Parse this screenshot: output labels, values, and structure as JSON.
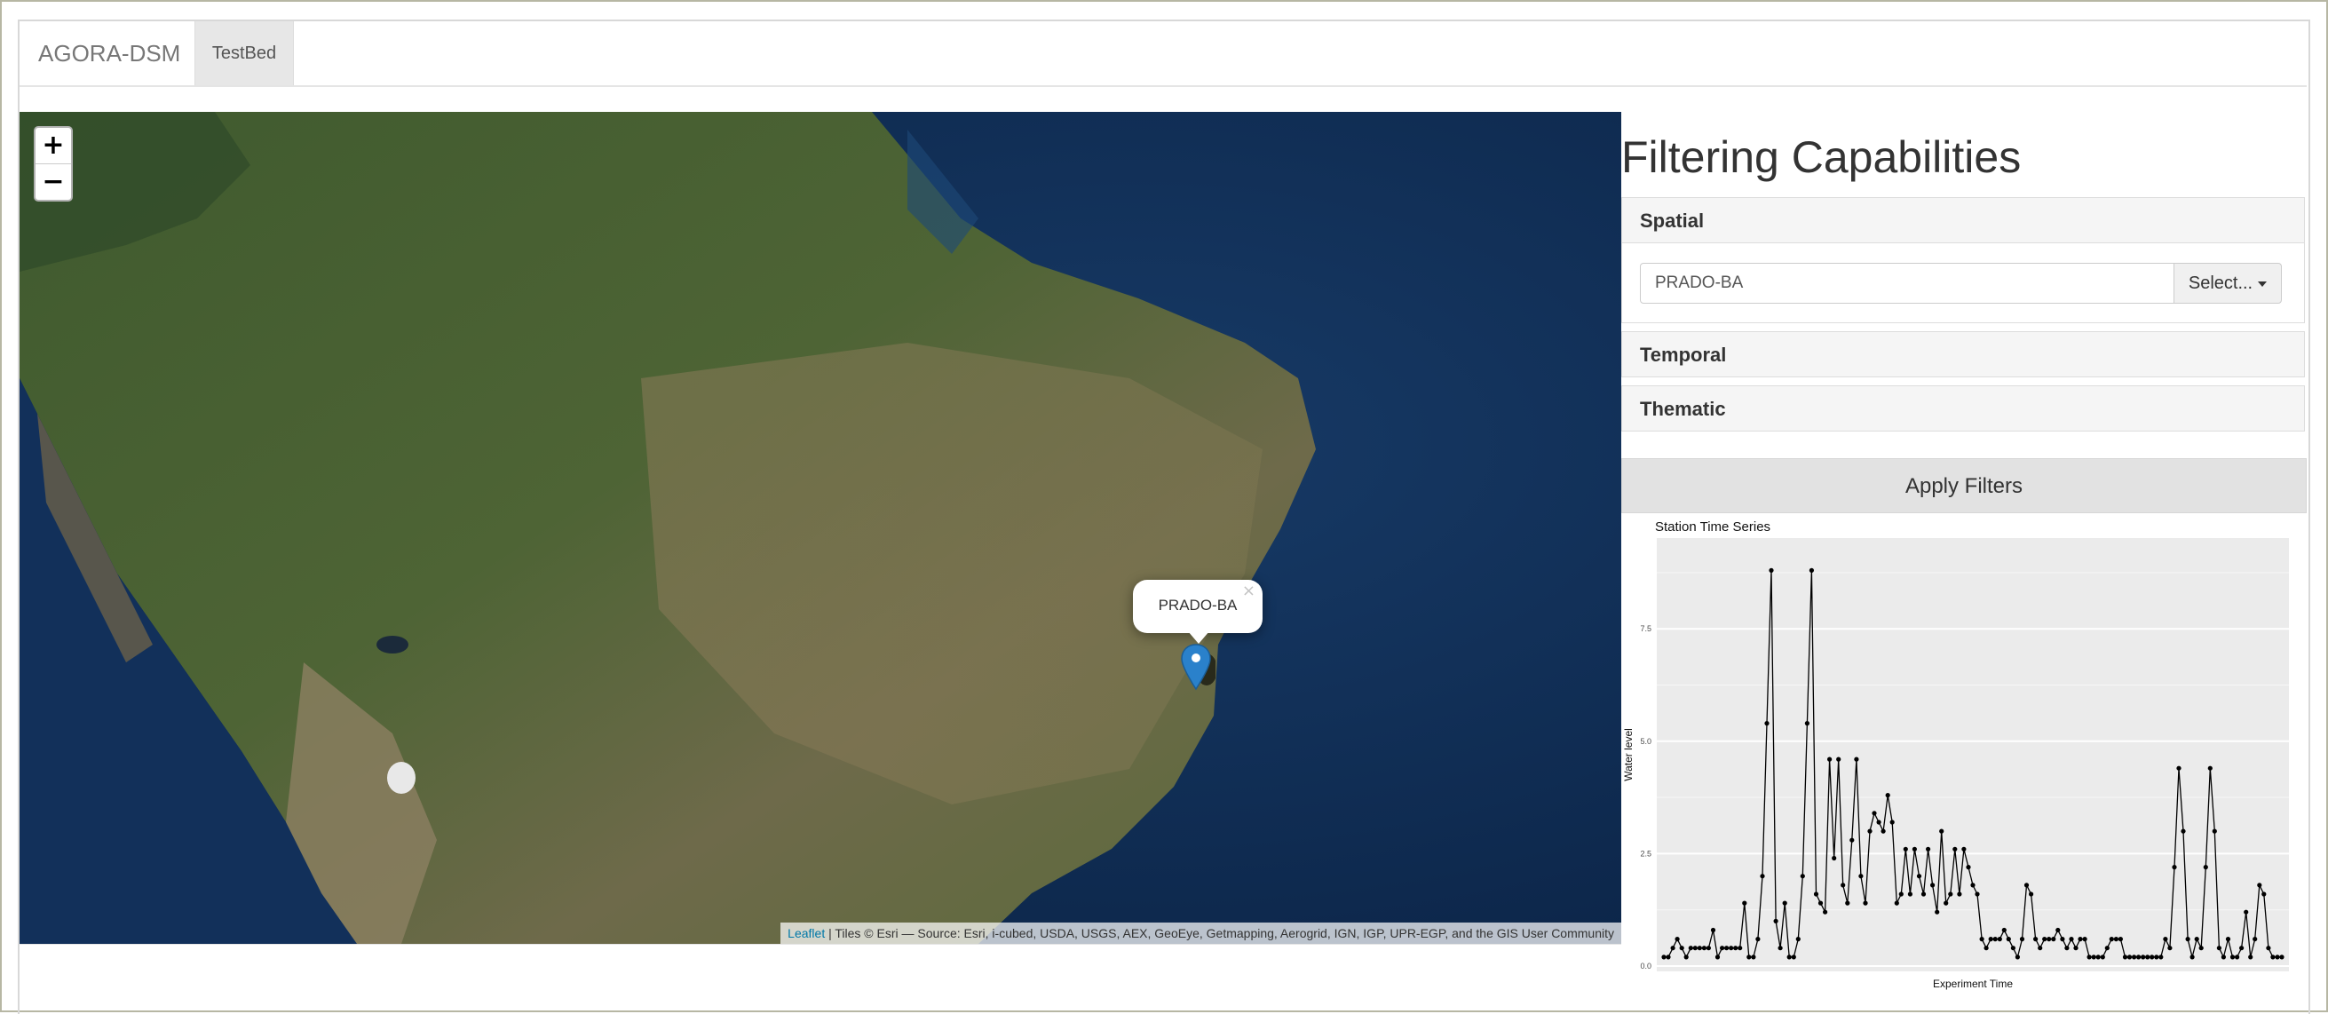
{
  "navbar": {
    "brand": "AGORA-DSM",
    "tabs": [
      {
        "label": "TestBed",
        "active": true
      }
    ]
  },
  "map": {
    "zoom_in": "+",
    "zoom_out": "−",
    "popup_label": "PRADO-BA",
    "popup_close": "×",
    "attribution": {
      "link": "Leaflet",
      "text": " | Tiles © Esri — Source: Esri, i-cubed, USDA, USGS, AEX, GeoEye, Getmapping, Aerogrid, IGN, IGP, UPR-EGP, and the GIS User Community"
    },
    "marker_color": "#2a81cb"
  },
  "panel": {
    "title": "Filtering Capabilities",
    "sections": {
      "spatial": "Spatial",
      "temporal": "Temporal",
      "thematic": "Thematic"
    },
    "spatial_value": "PRADO-BA",
    "select_label": "Select...",
    "apply_label": "Apply Filters"
  },
  "chart_data": {
    "type": "line",
    "title": "Station Time Series",
    "xlabel": "Experiment Time",
    "ylabel": "Water level",
    "ylim": [
      0,
      9.4
    ],
    "yticks": [
      "0.0",
      "2.5",
      "5.0",
      "7.5"
    ],
    "grid": true,
    "series": [
      {
        "values": [
          0.2,
          0.2,
          0.4,
          0.6,
          0.4,
          0.2,
          0.4,
          0.4,
          0.4,
          0.4,
          0.4,
          0.8,
          0.2,
          0.4,
          0.4,
          0.4,
          0.4,
          0.4,
          1.4,
          0.2,
          0.2,
          0.6,
          2.0,
          5.4,
          8.8,
          1.0,
          0.4,
          1.4,
          0.2,
          0.2,
          0.6,
          2.0,
          5.4,
          8.8,
          1.6,
          1.4,
          1.2,
          4.6,
          2.4,
          4.6,
          1.8,
          1.4,
          2.8,
          4.6,
          2.0,
          1.4,
          3.0,
          3.4,
          3.2,
          3.0,
          3.8,
          3.2,
          1.4,
          1.6,
          2.6,
          1.6,
          2.6,
          2.0,
          1.6,
          2.6,
          1.8,
          1.2,
          3.0,
          1.4,
          1.6,
          2.6,
          1.6,
          2.6,
          2.2,
          1.8,
          1.6,
          0.6,
          0.4,
          0.6,
          0.6,
          0.6,
          0.8,
          0.6,
          0.4,
          0.2,
          0.6,
          1.8,
          1.6,
          0.6,
          0.4,
          0.6,
          0.6,
          0.6,
          0.8,
          0.6,
          0.4,
          0.6,
          0.4,
          0.6,
          0.6,
          0.2,
          0.2,
          0.2,
          0.2,
          0.4,
          0.6,
          0.6,
          0.6,
          0.2,
          0.2,
          0.2,
          0.2,
          0.2,
          0.2,
          0.2,
          0.2,
          0.2,
          0.6,
          0.4,
          2.2,
          4.4,
          3.0,
          0.6,
          0.2,
          0.6,
          0.4,
          2.2,
          4.4,
          3.0,
          0.4,
          0.2,
          0.6,
          0.2,
          0.2,
          0.4,
          1.2,
          0.2,
          0.6,
          1.8,
          1.6,
          0.4,
          0.2,
          0.2,
          0.2
        ]
      }
    ]
  }
}
